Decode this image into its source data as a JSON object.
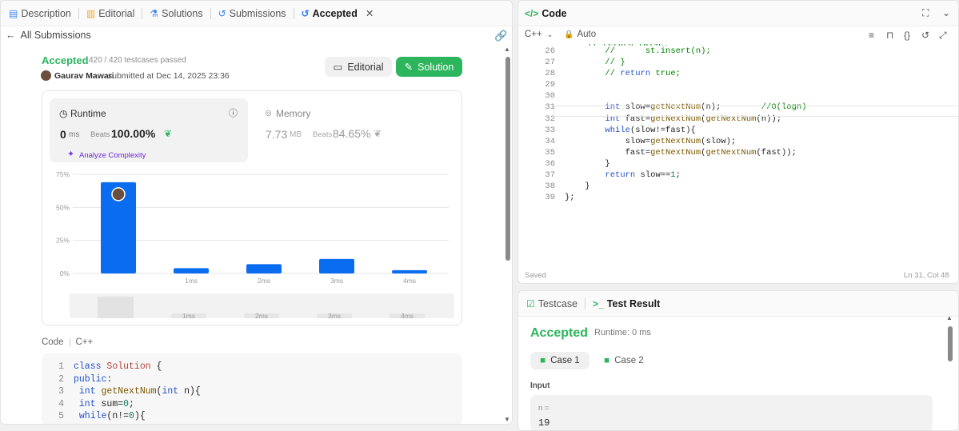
{
  "left_tabs": [
    "Description",
    "Editorial",
    "Solutions",
    "Submissions",
    "Accepted"
  ],
  "back_label": "All Submissions",
  "status": "Accepted",
  "testcases_passed": "420 / 420 testcases passed",
  "author": "Gaurav Mawari",
  "submitted_at": "submitted at Dec 14, 2025 23:36",
  "editorial_button": "Editorial",
  "solution_button": "Solution",
  "runtime": {
    "label": "Runtime",
    "value": "0",
    "unit": "ms",
    "beats_label": "Beats",
    "beats_value": "100.00%",
    "analyze": "Analyze Complexity"
  },
  "memory": {
    "label": "Memory",
    "value": "7.73",
    "unit": "MB",
    "beats_label": "Beats",
    "beats_value": "84.65%"
  },
  "chart_data": {
    "type": "bar",
    "categories": [
      "",
      "1ms",
      "2ms",
      "3ms",
      "4ms"
    ],
    "values": [
      69,
      4,
      7,
      11,
      2.5
    ],
    "y_ticks": [
      "75%",
      "50%",
      "25%",
      "0%"
    ],
    "ylim": [
      0,
      75
    ],
    "mini_labels": [
      "1ms",
      "2ms",
      "3ms",
      "4ms"
    ]
  },
  "code_label": "Code",
  "code_lang": "C++",
  "left_code_lines": [
    "1",
    "2",
    "3",
    "4",
    "5"
  ],
  "right_panel_title": "Code",
  "lang_select": "C++",
  "auto_label": "Auto",
  "editor_lines": [
    {
      "n": "26",
      "t": "        //      st.insert(n);"
    },
    {
      "n": "27",
      "t": "        // }"
    },
    {
      "n": "28",
      "t": "        // return true;"
    },
    {
      "n": "29",
      "t": ""
    },
    {
      "n": "30",
      "t": ""
    },
    {
      "n": "31",
      "t": "        int slow=getNextNum(n);        //O(logn)"
    },
    {
      "n": "32",
      "t": "        int fast=getNextNum(getNextNum(n));"
    },
    {
      "n": "33",
      "t": "        while(slow!=fast){"
    },
    {
      "n": "34",
      "t": "            slow=getNextNum(slow);"
    },
    {
      "n": "35",
      "t": "            fast=getNextNum(getNextNum(fast));"
    },
    {
      "n": "36",
      "t": "        }"
    },
    {
      "n": "37",
      "t": "        return slow==1;"
    },
    {
      "n": "38",
      "t": "    }"
    },
    {
      "n": "39",
      "t": "};"
    }
  ],
  "saved_label": "Saved",
  "cursor_pos": "Ln 31, Col 48",
  "test_tabs": [
    "Testcase",
    "Test Result"
  ],
  "result_status": "Accepted",
  "result_runtime": "Runtime: 0 ms",
  "cases": [
    "Case 1",
    "Case 2"
  ],
  "input_label": "Input",
  "input_var": "n =",
  "input_value": "19"
}
